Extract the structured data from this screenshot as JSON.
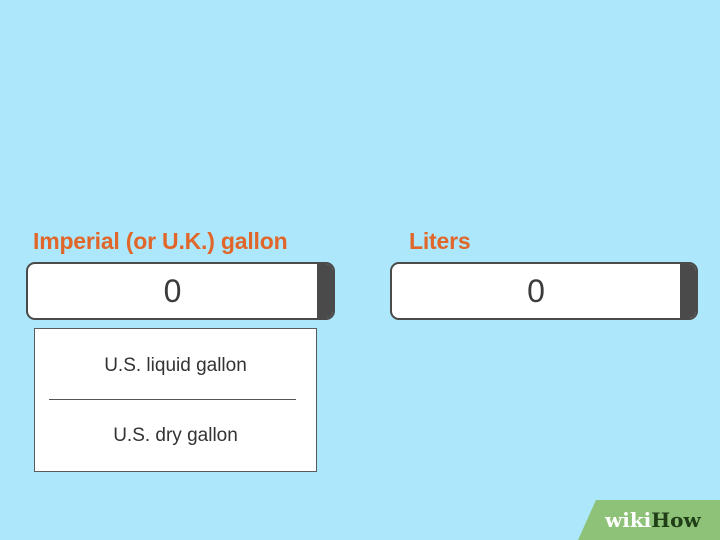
{
  "converter": {
    "from": {
      "label": "Imperial (or U.K.) gallon",
      "value": "0"
    },
    "to": {
      "label": "Liters",
      "value": "0"
    },
    "from_unit_options": [
      "U.S. liquid gallon",
      "U.S. dry gallon"
    ]
  },
  "watermark": {
    "part1": "wiki",
    "part2": "How"
  },
  "colors": {
    "background": "#ade7fb",
    "label_orange": "#e0662a",
    "input_border": "#4a4a4a",
    "watermark_green": "#8cbf6e"
  }
}
